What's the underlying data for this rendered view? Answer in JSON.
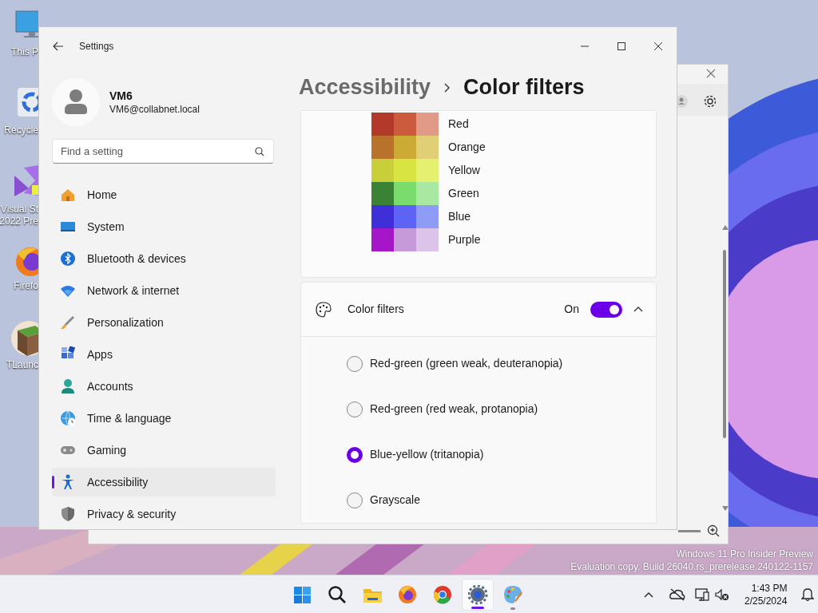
{
  "desktop_icons": [
    {
      "lines": [
        "This P"
      ]
    },
    {
      "lines": [
        "Recycle"
      ]
    },
    {
      "lines": [
        "Visual St",
        "2022 Pre"
      ]
    },
    {
      "lines": [
        "Firefo"
      ]
    },
    {
      "lines": [
        "TLaunc"
      ]
    }
  ],
  "settings": {
    "title": "Settings",
    "user": {
      "name": "VM6",
      "email": "VM6@collabnet.local"
    },
    "search": {
      "placeholder": "Find a setting"
    },
    "nav": [
      {
        "label": "Home",
        "selected": false
      },
      {
        "label": "System",
        "selected": false
      },
      {
        "label": "Bluetooth & devices",
        "selected": false
      },
      {
        "label": "Network & internet",
        "selected": false
      },
      {
        "label": "Personalization",
        "selected": false
      },
      {
        "label": "Apps",
        "selected": false
      },
      {
        "label": "Accounts",
        "selected": false
      },
      {
        "label": "Time & language",
        "selected": false
      },
      {
        "label": "Gaming",
        "selected": false
      },
      {
        "label": "Accessibility",
        "selected": true
      },
      {
        "label": "Privacy & security",
        "selected": false
      }
    ],
    "breadcrumb": [
      "Accessibility",
      "Color filters"
    ],
    "palette": [
      {
        "label": "Red",
        "swatches": [
          {
            "color": "#b33a2a"
          },
          {
            "color": "#cc5a3c"
          },
          {
            "color": "#e09a85"
          }
        ]
      },
      {
        "label": "Orange",
        "swatches": [
          {
            "color": "#b8722a"
          },
          {
            "color": "#ccab35"
          },
          {
            "color": "#e0cf75"
          }
        ]
      },
      {
        "label": "Yellow",
        "swatches": [
          {
            "color": "#c8cf38"
          },
          {
            "color": "#d7e442"
          },
          {
            "color": "#e4f070"
          }
        ]
      },
      {
        "label": "Green",
        "swatches": [
          {
            "color": "#3a8236"
          },
          {
            "color": "#79dc6c"
          },
          {
            "color": "#a9e8a0"
          }
        ]
      },
      {
        "label": "Blue",
        "swatches": [
          {
            "color": "#3f2fd8"
          },
          {
            "color": "#5c63f5"
          },
          {
            "color": "#8f9cf5"
          }
        ]
      },
      {
        "label": "Purple",
        "swatches": [
          {
            "color": "#a416c8"
          },
          {
            "color": "#c699d8"
          },
          {
            "color": "#dcc3ea"
          }
        ]
      }
    ],
    "color_filters": {
      "label": "Color filters",
      "state_text": "On",
      "on": true,
      "expanded": true,
      "options": [
        {
          "label": "Red-green (green weak, deuteranopia)",
          "selected": false
        },
        {
          "label": "Red-green (red weak, protanopia)",
          "selected": false
        },
        {
          "label": "Blue-yellow (tritanopia)",
          "selected": true
        },
        {
          "label": "Grayscale",
          "selected": false
        }
      ]
    }
  },
  "watermark": [
    "Windows 11 Pro Insider Preview",
    "Evaluation copy. Build 26040.rs_prerelease.240122-1157"
  ],
  "taskbar": {
    "apps": [
      {
        "selected": false,
        "running": false
      },
      {
        "selected": false,
        "running": false
      },
      {
        "selected": false,
        "running": false
      },
      {
        "selected": false,
        "running": false
      },
      {
        "selected": false,
        "running": false
      },
      {
        "selected": true,
        "running": true
      },
      {
        "selected": false,
        "running": true
      }
    ],
    "time": "1:43 PM",
    "date": "2/25/2024"
  }
}
